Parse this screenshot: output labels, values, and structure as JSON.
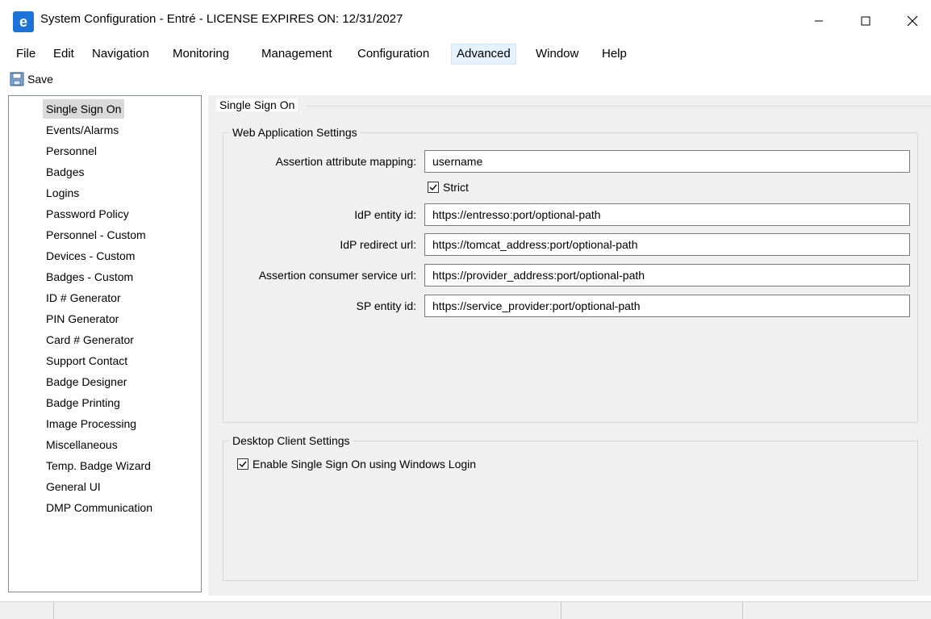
{
  "window": {
    "icon": "app-e-icon",
    "icon_glyph": "e",
    "title": "System Configuration - Entré - LICENSE EXPIRES ON: 12/31/2027"
  },
  "menu": [
    "File",
    "Edit",
    "Navigation",
    "Monitoring",
    "Management",
    "Configuration",
    "Advanced",
    "Window",
    "Help"
  ],
  "menu_active": "Advanced",
  "toolbar": {
    "save_label": "Save",
    "save_icon": "floppy-disk-icon"
  },
  "nav": {
    "selected": "Single Sign On",
    "items": [
      "Single Sign On",
      "Events/Alarms",
      "Personnel",
      "Badges",
      "Logins",
      "Password Policy",
      "Personnel - Custom",
      "Devices - Custom",
      "Badges - Custom",
      "ID # Generator",
      "PIN Generator",
      "Card # Generator",
      "Support Contact",
      "Badge Designer",
      "Badge Printing",
      "Image Processing",
      "Miscellaneous",
      "Temp. Badge Wizard",
      "General UI",
      "DMP Communication"
    ]
  },
  "panel": {
    "title": "Single Sign On",
    "web": {
      "title": "Web Application Settings",
      "assertion_mapping_label": "Assertion attribute mapping:",
      "assertion_mapping_value": "username",
      "strict_label": "Strict",
      "strict_checked": true,
      "idp_entity_label": "IdP entity id:",
      "idp_entity_value": "https://entresso:port/optional-path",
      "idp_redirect_label": "IdP redirect url:",
      "idp_redirect_value": "https://tomcat_address:port/optional-path",
      "acs_label": "Assertion consumer service url:",
      "acs_value": "https://provider_address:port/optional-path",
      "sp_entity_label": "SP entity id:",
      "sp_entity_value": "https://service_provider:port/optional-path"
    },
    "desktop": {
      "title": "Desktop Client Settings",
      "sso_windows_label": "Enable Single Sign On using Windows Login",
      "sso_windows_checked": true
    }
  },
  "colors": {
    "selection": "#d9d9d9",
    "menu_highlight": "#e5f1fb",
    "panel_bg": "#f0f0f0",
    "app_icon": "#1e73d8"
  }
}
